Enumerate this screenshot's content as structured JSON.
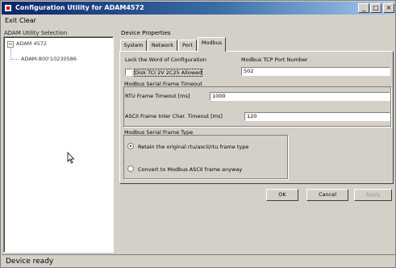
{
  "window": {
    "title": "Configuration Utility for ADAM4572",
    "minimize_glyph": "_",
    "maximize_glyph": "□",
    "close_glyph": "×"
  },
  "menu": {
    "items": [
      "Exit",
      "Clear"
    ]
  },
  "tree": {
    "label": "ADAM Utility Selection",
    "root": "ADAM 4572",
    "child": "ADAM-800'10230586"
  },
  "properties": {
    "label": "Device Properties",
    "tabs": [
      "System",
      "Network",
      "Port",
      "Modbus"
    ],
    "active_tab": "Modbus",
    "lock_config_label": "Lock the Word of Configuration",
    "lock_config_checkbox_text": "Disk TCI 2V 2C25 Allowed",
    "lock_config_checked": false,
    "tcp_port_label": "Modbus TCP Port Number",
    "tcp_port_value": "502",
    "serial_timeout_group": "Modbus Serial Frame Timeout",
    "rtu_timeout_label": "RTU Frame Timeout [ms]",
    "rtu_timeout_value": "1000",
    "ascii_timeout_label": "ASCII Frame Inter Char. Timeout [ms]",
    "ascii_timeout_value": "120",
    "frame_type_group": "Modbus Serial Frame Type",
    "frame_type_options": [
      "Retain the original rtu/ascii/rtu frame type",
      "Convert to Modbus ASCII frame anyway"
    ],
    "frame_type_selected": 0
  },
  "buttons": {
    "ok": "OK",
    "cancel": "Cancel",
    "apply": "Apply"
  },
  "status": {
    "text": "Device ready"
  }
}
